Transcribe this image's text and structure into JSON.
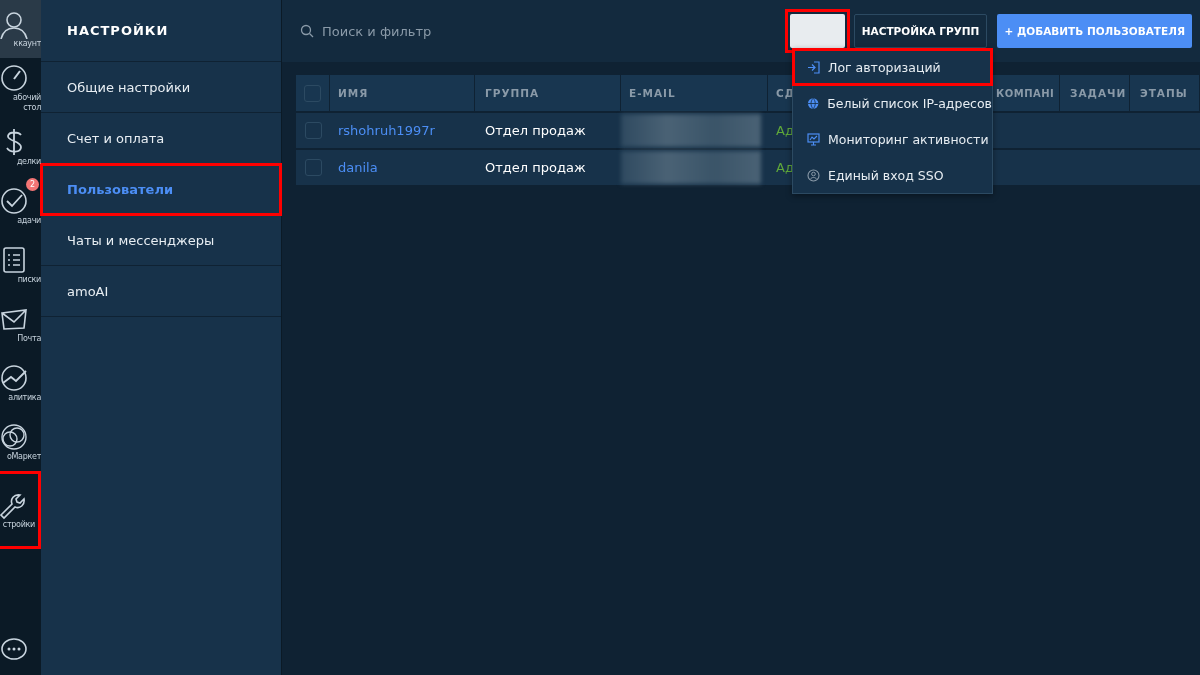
{
  "nav_rail": {
    "items": [
      {
        "label": "ккаунт",
        "highlighted": false
      },
      {
        "label": "абочий стол",
        "highlighted": false
      },
      {
        "label": "делки",
        "highlighted": false
      },
      {
        "label": "адачи",
        "badge": "2",
        "highlighted": false
      },
      {
        "label": "писки",
        "highlighted": false
      },
      {
        "label": "Почта",
        "highlighted": false
      },
      {
        "label": "алитика",
        "highlighted": false
      },
      {
        "label": "оМаркет",
        "highlighted": false
      },
      {
        "label": "стройки",
        "highlighted": true
      },
      {
        "highlighted": false
      }
    ]
  },
  "settings_panel": {
    "title": "НАСТРОЙКИ",
    "items": [
      {
        "label": "Общие настройки",
        "selected": false,
        "highlighted": false
      },
      {
        "label": "Счет и оплата",
        "selected": false,
        "highlighted": false
      },
      {
        "label": "Пользователи",
        "selected": true,
        "highlighted": true
      },
      {
        "label": "Чаты и мессенджеры",
        "selected": false,
        "highlighted": false
      },
      {
        "label": "amoAI",
        "selected": false,
        "highlighted": false
      }
    ]
  },
  "toolbar": {
    "search": {
      "placeholder": "Поиск и фильтр"
    },
    "more_button": {
      "highlighted": true
    },
    "group_button": "НАСТРОЙКА ГРУПП",
    "add_button": "+ ДОБАВИТЬ ПОЛЬЗОВАТЕЛЯ"
  },
  "table": {
    "header_checked": false,
    "columns": [
      "ИМЯ",
      "ГРУППА",
      "E-MAIL",
      "СД",
      "КОМПАНІ",
      "ЗАДАЧИ",
      "ЭТАПЫ"
    ],
    "rows": [
      {
        "checked": false,
        "name": "rshohruh1997r",
        "group": "Отдел продаж",
        "column_4": "Ад"
      },
      {
        "checked": false,
        "name": "danila",
        "group": "Отдел продаж",
        "column_4": "Ад"
      }
    ]
  },
  "dropdown": {
    "items": [
      {
        "label": "Лог авторизаций",
        "highlighted": true
      },
      {
        "label": "Белый список IP-адресов",
        "highlighted": false
      },
      {
        "label": "Мониторинг активности",
        "highlighted": false
      },
      {
        "label": "Единый вход SSO",
        "highlighted": false
      }
    ]
  }
}
